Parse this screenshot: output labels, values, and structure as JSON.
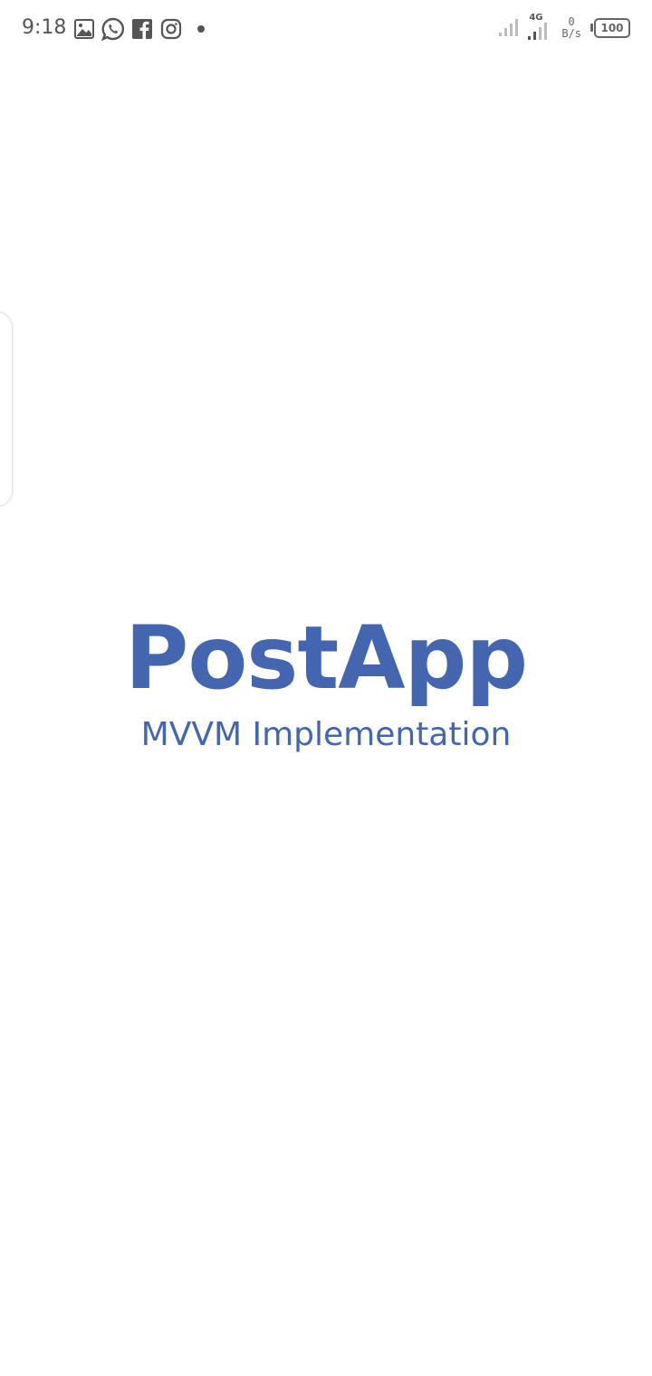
{
  "status_bar": {
    "time": "9:18",
    "notification_icons": [
      "gallery-icon",
      "whatsapp-icon",
      "facebook-icon",
      "instagram-icon",
      "more-dot-icon"
    ],
    "network_type": "4G",
    "net_speed_value": "0",
    "net_speed_unit": "B/s",
    "battery_level": "100"
  },
  "splash": {
    "app_name": "PostApp",
    "subtitle": "MVVM Implementation"
  },
  "colors": {
    "brand": "#4466b0",
    "status_icon": "#555555",
    "background": "#ffffff"
  }
}
